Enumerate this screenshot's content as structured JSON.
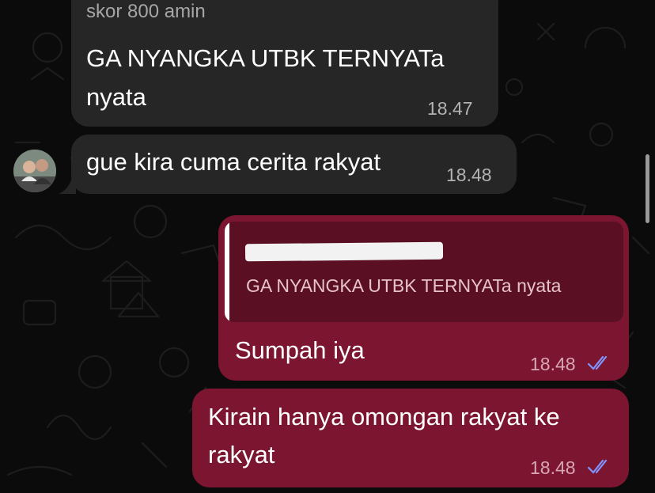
{
  "messages": [
    {
      "id": "m1",
      "direction": "incoming",
      "sender_clip": "skor 800 amin",
      "lines": [
        "GA NYANGKA UTBK TERNYATa",
        "nyata"
      ],
      "time": "18.47"
    },
    {
      "id": "m2",
      "direction": "incoming",
      "lines": [
        "gue kira cuma cerita rakyat"
      ],
      "time": "18.48",
      "avatar_icon": "contact-avatar"
    },
    {
      "id": "m3",
      "direction": "outgoing",
      "quote": {
        "text": "GA NYANGKA UTBK TERNYATa nyata"
      },
      "lines": [
        "Sumpah iya"
      ],
      "time": "18.48",
      "status_icon": "double-check-read-icon"
    },
    {
      "id": "m4",
      "direction": "outgoing",
      "lines": [
        "Kirain hanya omongan rakyat ke",
        "rakyat"
      ],
      "time": "18.48",
      "status_icon": "double-check-read-icon"
    }
  ],
  "colors": {
    "background": "#0b0b0b",
    "incoming_bubble": "#262626",
    "outgoing_bubble": "#7b1530",
    "quote_box": "#5a0f22",
    "read_ticks": "#7f95ff"
  }
}
